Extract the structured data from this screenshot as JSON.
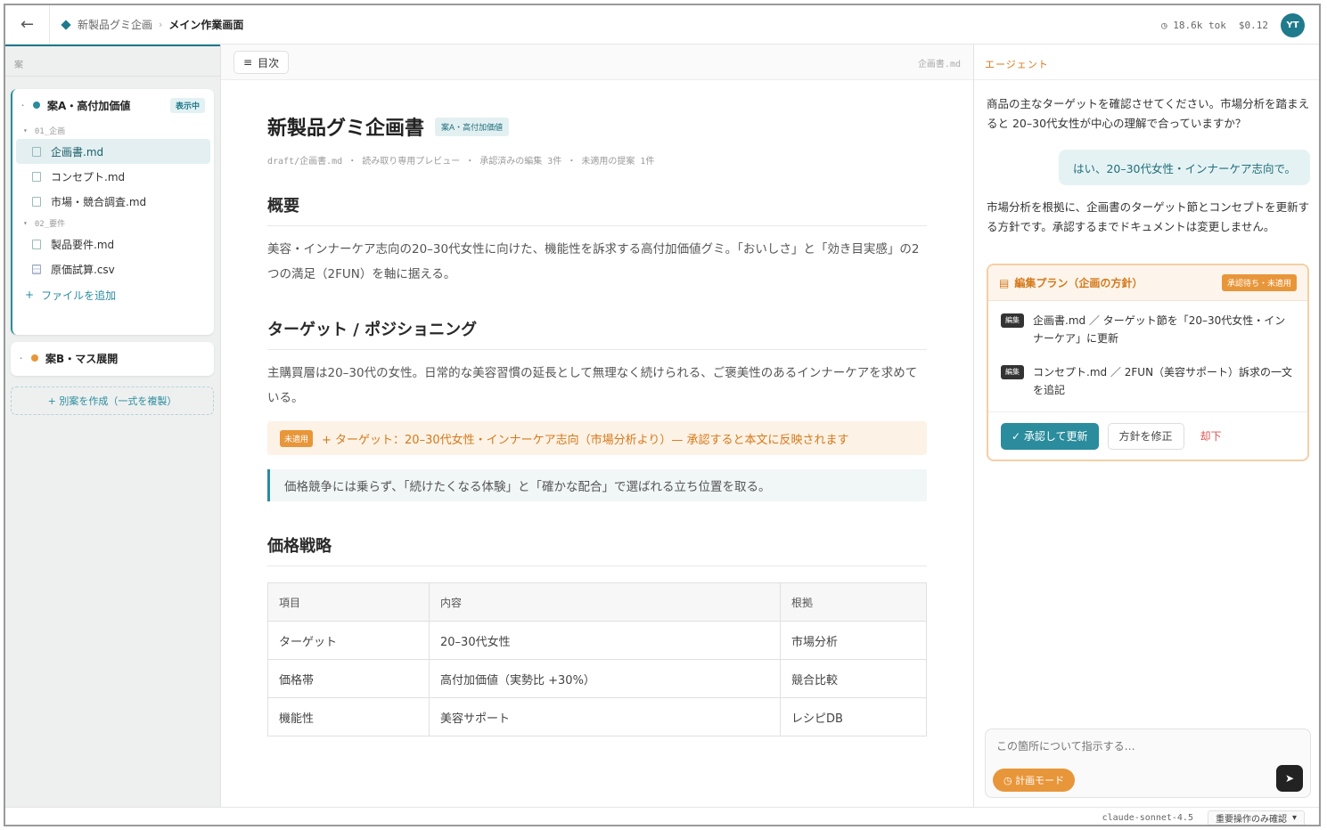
{
  "topbar": {
    "back_icon": "arrow-left-icon",
    "breadcrumb_project": "新製品グミ企画",
    "breadcrumb_page": "メイン作業画面",
    "tokens": "18.6k tok",
    "cost": "$0.12",
    "avatar": "YT"
  },
  "sidebar": {
    "header": "案",
    "plan_a": {
      "name": "案A・高付加価値",
      "badge": "表示中",
      "dot_color": "#2a8c9c"
    },
    "folders": [
      {
        "name": "01_企画",
        "files": [
          {
            "name": "企画書.md",
            "active": true
          },
          {
            "name": "コンセプト.md"
          },
          {
            "name": "市場・競合調査.md"
          }
        ]
      },
      {
        "name": "02_要件",
        "files": [
          {
            "name": "製品要件.md"
          },
          {
            "name": "原価試算.csv"
          }
        ]
      }
    ],
    "add_file": "ファイルを追加",
    "plan_b": {
      "name": "案B・マス展開",
      "dot_color": "#e8963a"
    },
    "new_plan": "+ 別案を作成（一式を複製）"
  },
  "document": {
    "toc_label": "目次",
    "filename": "企画書.md",
    "title": "新製品グミ企画書",
    "plan_tag": "案A・高付加価値",
    "meta": "draft/企画書.md ・ 読み取り専用プレビュー ・ 承認済みの編集 3件 ・ 未適用の提案 1件",
    "sections": {
      "overview_heading": "概要",
      "overview_text": "美容・インナーケア志向の20–30代女性に向けた、機能性を訴求する高付加価値グミ。「おいしさ」と「効き目実感」の2つの満足（2FUN）を軸に据える。",
      "target_heading": "ターゲット / ポジショニング",
      "target_text": "主購買層は20–30代の女性。日常的な美容習慣の延長として無理なく続けられる、ご褒美性のあるインナーケアを求めている。",
      "unapplied_tag": "未適用",
      "unapplied_text": "+ ターゲット：20–30代女性・インナーケア志向（市場分析より）— 承認すると本文に反映されます",
      "quote_text": "価格競争には乗らず、「続けたくなる体験」と「確かな配合」で選ばれる立ち位置を取る。",
      "pricing_heading": "価格戦略"
    },
    "table": {
      "headers": [
        "項目",
        "内容",
        "根拠"
      ],
      "rows": [
        [
          "ターゲット",
          "20–30代女性",
          "市場分析"
        ],
        [
          "価格帯",
          "高付加価値（実勢比 +30%）",
          "競合比較"
        ],
        [
          "機能性",
          "美容サポート",
          "レシピDB"
        ]
      ]
    }
  },
  "agent": {
    "title": "エージェント",
    "message_1": "商品の主なターゲットを確認させてください。市場分析を踏まえると 20–30代女性が中心の理解で合っていますか？",
    "user_reply": "はい、20–30代女性・インナーケア志向で。",
    "message_2": "市場分析を根拠に、企画書のターゲット節とコンセプトを更新する方針です。承認するまでドキュメントは変更しません。",
    "plan": {
      "title": "編集プラン（企画の方針）",
      "status": "承認待ち・未適用",
      "items": [
        {
          "tag": "編集",
          "text": "企画書.md ／ ターゲット節を「20–30代女性・インナーケア」に更新"
        },
        {
          "tag": "編集",
          "text": "コンセプト.md ／ 2FUN（美容サポート）訴求の一文を追記"
        }
      ],
      "approve": "✓ 承認して更新",
      "revise": "方針を修正",
      "reject": "却下"
    },
    "composer_placeholder": "この箇所について指示する…",
    "mode": "◷ 計画モード",
    "send_icon": "send-icon"
  },
  "statusbar": {
    "model": "claude-sonnet-4.5",
    "confirm_mode": "重要操作のみ確認"
  },
  "colors": {
    "accent": "#2a8c9c",
    "warning": "#e8963a"
  }
}
